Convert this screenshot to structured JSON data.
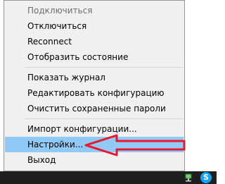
{
  "menu": {
    "items": [
      {
        "label": "Подключиться",
        "disabled": true
      },
      {
        "label": "Отключиться"
      },
      {
        "label": "Reconnect"
      },
      {
        "label": "Отобразить состояние"
      },
      {
        "label": "Показать журнал"
      },
      {
        "label": "Редактировать конфигурацию"
      },
      {
        "label": "Очистить сохраненные пароли"
      },
      {
        "label": "Импорт конфигурации..."
      },
      {
        "label": "Настройки...",
        "highlighted": true
      },
      {
        "label": "Выход"
      }
    ]
  },
  "annotation": {
    "arrow_color": "#e8192c"
  },
  "taskbar": {
    "network_icon": "network-icon",
    "skype_icon": "skype-icon",
    "skype_glyph": "S"
  },
  "colors": {
    "menu_bg": "#f0f0f0",
    "highlight": "#91c9f7",
    "taskbar": "#1f1f1f",
    "skype": "#12a5f4"
  }
}
